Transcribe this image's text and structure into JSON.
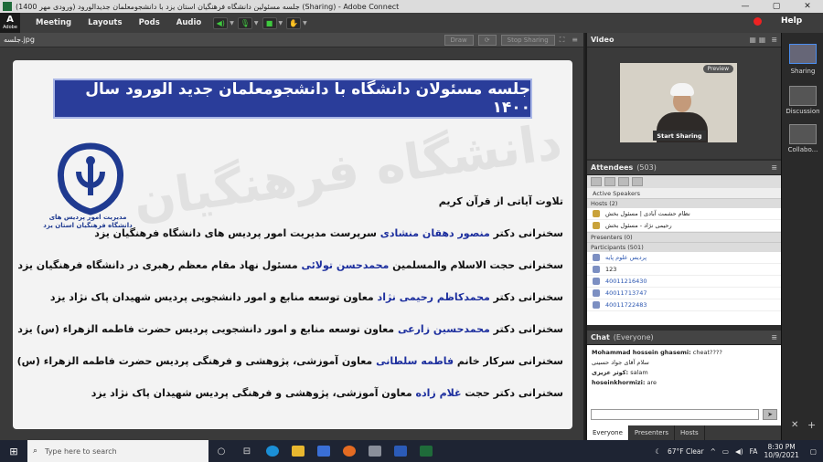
{
  "window": {
    "title": "(1400 جلسه مسئولین دانشگاه فرهنگیان استان یزد با دانشجومعلمان جدیدالورود (ورودی مهر (Sharing) - Adobe Connect",
    "minimize": "—",
    "maximize": "▢",
    "close": "✕"
  },
  "menubar": {
    "logo_top": "A",
    "logo_bottom": "Adobe",
    "items": [
      "Meeting",
      "Layouts",
      "Pods",
      "Audio"
    ],
    "help": "Help"
  },
  "share_pod": {
    "filename": "جلسه.jpg",
    "draw": "Draw",
    "stop_sharing": "Stop Sharing"
  },
  "slide": {
    "banner": "جلسه مسئولان دانشگاه با دانشجومعلمان جدید الورود سال ۱۴۰۰",
    "bg_text": "دانشگاه فرهنگیان",
    "logo_caption_1": "مدیریت امور پردیس های",
    "logo_caption_2": "دانشگاه فرهنگیان استان یزد",
    "lines": [
      {
        "pre": "تلاوت آیاتی از قرآن کریم",
        "hl": "",
        "post": ""
      },
      {
        "pre": "سخنرانی دکتر ",
        "hl": "منصور دهقان منشادی",
        "post": " سرپرست مدیریت امور پردیس های دانشگاه فرهنگیان یزد"
      },
      {
        "pre": "سخنرانی حجت الاسلام والمسلمین ",
        "hl": "محمدحسن تولائی",
        "post": " مسئول نهاد مقام معظم رهبری در دانشگاه فرهنگیان یزد"
      },
      {
        "pre": "سخنرانی دکتر ",
        "hl": "محمدکاظم رحیمی نژاد",
        "post": " معاون توسعه منابع و امور دانشجویی پردیس شهیدان پاک نژاد یزد"
      },
      {
        "pre": "سخنرانی دکتر ",
        "hl": "محمدحسین زارعی",
        "post": " معاون توسعه منابع و امور دانشجویی پردیس حضرت فاطمه الزهراء (س) یزد"
      },
      {
        "pre": "سخنرانی سرکار خانم ",
        "hl": "فاطمه سلطانی",
        "post": " معاون آموزشی، پژوهشی و فرهنگی پردیس حضرت فاطمه الزهراء (س) یزد"
      },
      {
        "pre": "سخنرانی دکتر حجت ",
        "hl": "غلام زاده",
        "post": " معاون آموزشی، پژوهشی و فرهنگی پردیس شهیدان پاک نژاد یزد"
      }
    ]
  },
  "video": {
    "title": "Video",
    "preview": "Preview",
    "start_sharing": "Start Sharing"
  },
  "attendees": {
    "title": "Attendees",
    "count": "(503)",
    "active_speakers": "Active Speakers",
    "hosts_label": "Hosts (2)",
    "hosts": [
      "نظام حشمت‌ آبادی | مسئول بخش",
      "رحیمی نژاد - مسئول بخش"
    ],
    "presenters_label": "Presenters (0)",
    "participants_label": "Participants (501)",
    "participants": [
      "پردیس علوم پایه",
      "123",
      "40011216430",
      "40011713747",
      "40011722483"
    ]
  },
  "chat": {
    "title": "Chat",
    "scope": "(Everyone)",
    "messages": [
      {
        "who": "Mohammad hossein ghasemi:",
        "text": " cheat????"
      },
      {
        "who": "",
        "text": "سلام آقای جواد حسینی"
      },
      {
        "who": "کوثر عزیزی:",
        "text": " salam"
      },
      {
        "who": "hoseinkhormizi:",
        "text": " are"
      }
    ],
    "tabs": [
      "Everyone",
      "Presenters",
      "Hosts"
    ]
  },
  "layouts": {
    "items": [
      "Sharing",
      "Discussion",
      "Collabo..."
    ]
  },
  "taskbar": {
    "search_placeholder": "Type here to search",
    "weather": "67°F  Clear",
    "lang": "FA",
    "time": "8:30 PM",
    "date": "10/9/2021"
  }
}
